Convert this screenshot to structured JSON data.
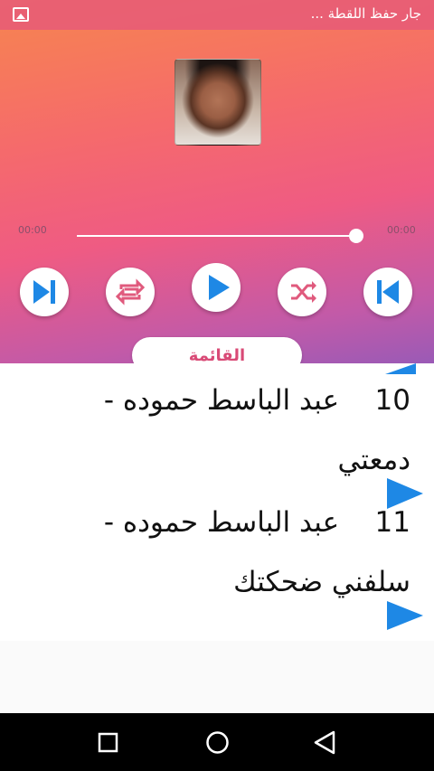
{
  "status_bar": {
    "text": "جار حفظ اللقطة ...",
    "icon": "gallery-icon"
  },
  "player": {
    "elapsed": "00:00",
    "duration": "00:00",
    "progress": 1.0,
    "controls": [
      "skip-next-icon",
      "repeat-icon",
      "play-icon",
      "shuffle-icon",
      "skip-previous-icon"
    ],
    "accent_color": "#1e88e5"
  },
  "tab": {
    "label": "القائمة"
  },
  "tracks": [
    {
      "number": "10",
      "line1": "عبد الباسط حموده -",
      "line2": "دمعتي"
    },
    {
      "number": "11",
      "line1": "عبد الباسط حموده -",
      "line2": "سلفني ضحكتك"
    }
  ],
  "nav": [
    "square-icon",
    "circle-icon",
    "back-triangle-icon"
  ]
}
